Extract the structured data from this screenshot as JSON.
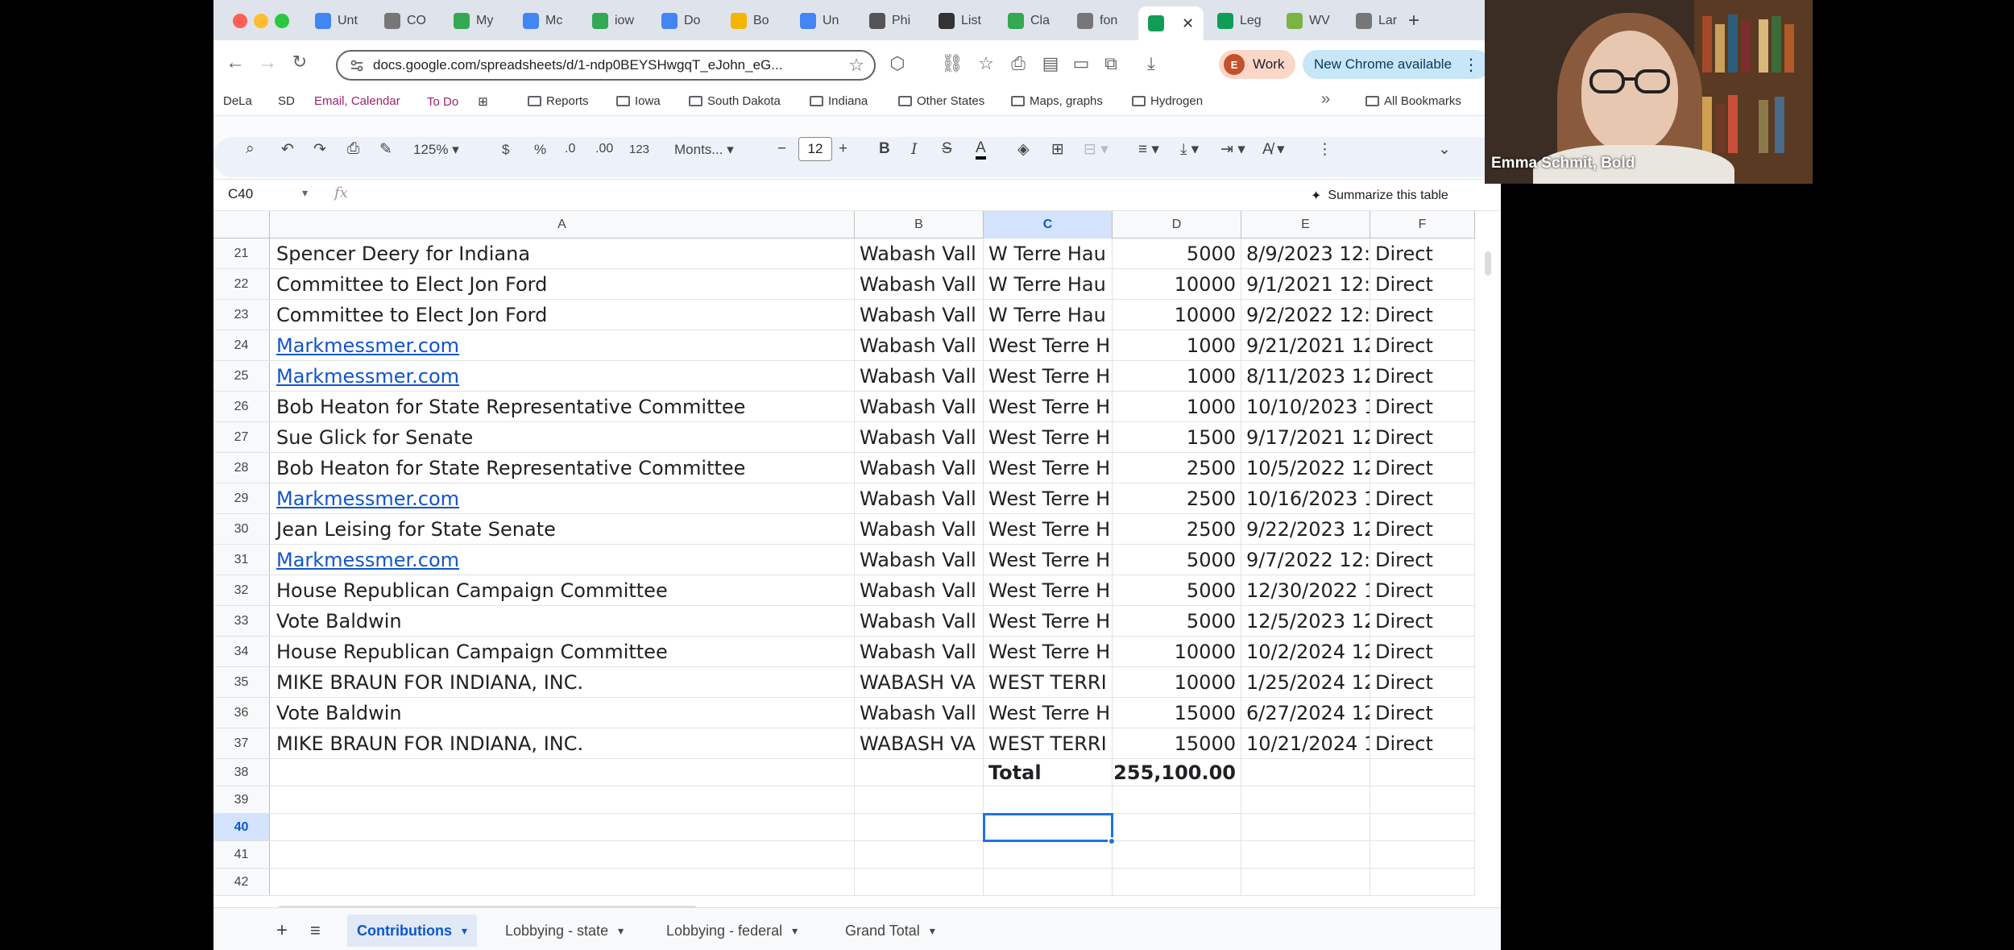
{
  "browser": {
    "tabs": [
      {
        "label": "Unt",
        "color": "#4285f4"
      },
      {
        "label": "CO",
        "color": "#777777"
      },
      {
        "label": "My",
        "color": "#34a853"
      },
      {
        "label": "Mc",
        "color": "#4285f4"
      },
      {
        "label": "iow",
        "color": "#34a853"
      },
      {
        "label": "Do",
        "color": "#4285f4"
      },
      {
        "label": "Bo",
        "color": "#f4b400"
      },
      {
        "label": "Un",
        "color": "#4285f4"
      },
      {
        "label": "Phi",
        "color": "#555555"
      },
      {
        "label": "List",
        "color": "#333333"
      },
      {
        "label": "Cla",
        "color": "#34a853"
      },
      {
        "label": "fon",
        "color": "#777777"
      },
      {
        "label": "",
        "color": "#0f9d58",
        "active": true
      },
      {
        "label": "Leg",
        "color": "#0f9d58"
      },
      {
        "label": "WV",
        "color": "#7cb342"
      },
      {
        "label": "Lar",
        "color": "#777777"
      }
    ],
    "url": "docs.google.com/spreadsheets/d/1-ndp0BEYSHwgqT_eJohn_eG...",
    "profile_label": "Work",
    "profile_initial": "E",
    "update_label": "New Chrome available",
    "bookmarks": [
      {
        "label": "DeLa",
        "folder": false
      },
      {
        "label": "SD",
        "folder": false
      },
      {
        "label": "Email, Calendar",
        "folder": false
      },
      {
        "label": "To Do",
        "folder": false
      },
      {
        "label": "Reports",
        "folder": true
      },
      {
        "label": "Iowa",
        "folder": true
      },
      {
        "label": "South Dakota",
        "folder": true
      },
      {
        "label": "Indiana",
        "folder": true
      },
      {
        "label": "Other States",
        "folder": true
      },
      {
        "label": "Maps, graphs",
        "folder": true
      },
      {
        "label": "Hydrogen",
        "folder": true
      }
    ],
    "all_bookmarks": "All Bookmarks"
  },
  "sheets": {
    "zoom": "125%",
    "currency": "$",
    "percent": "%",
    "dec_less": ".0",
    "dec_more": ".00",
    "number_format": "123",
    "font": "Monts...",
    "font_size": "12",
    "name_box": "C40",
    "fx": "fx",
    "summarize": "Summarize this table",
    "columns": [
      "A",
      "B",
      "C",
      "D",
      "E",
      "F"
    ],
    "rows": [
      {
        "n": "21",
        "a": "Spencer Deery for Indiana",
        "b": "Wabash Vall",
        "c": "W Terre Hau",
        "d": "5000",
        "e": "8/9/2023 12:0",
        "f": "Direct"
      },
      {
        "n": "22",
        "a": "Committee to Elect Jon Ford",
        "b": "Wabash Vall",
        "c": "W Terre Hau",
        "d": "10000",
        "e": "9/1/2021 12:0(",
        "f": "Direct"
      },
      {
        "n": "23",
        "a": "Committee to Elect Jon Ford",
        "b": "Wabash Vall",
        "c": "W Terre Hau",
        "d": "10000",
        "e": "9/2/2022 12:0",
        "f": "Direct"
      },
      {
        "n": "24",
        "a": "Markmessmer.com",
        "b": "Wabash Vall",
        "c": "West Terre H",
        "d": "1000",
        "e": "9/21/2021 12:0",
        "f": "Direct",
        "link": true
      },
      {
        "n": "25",
        "a": "Markmessmer.com",
        "b": "Wabash Vall",
        "c": "West Terre H",
        "d": "1000",
        "e": "8/11/2023 12:0",
        "f": "Direct",
        "link": true
      },
      {
        "n": "26",
        "a": "Bob Heaton for State Representative Committee",
        "b": "Wabash Vall",
        "c": "West Terre H",
        "d": "1000",
        "e": "10/10/2023 12",
        "f": "Direct"
      },
      {
        "n": "27",
        "a": "Sue Glick for Senate",
        "b": "Wabash Vall",
        "c": "West Terre H",
        "d": "1500",
        "e": "9/17/2021 12:0",
        "f": "Direct"
      },
      {
        "n": "28",
        "a": "Bob Heaton for State Representative Committee",
        "b": "Wabash Vall",
        "c": "West Terre H",
        "d": "2500",
        "e": "10/5/2022 12:",
        "f": "Direct"
      },
      {
        "n": "29",
        "a": "Markmessmer.com",
        "b": "Wabash Vall",
        "c": "West Terre H",
        "d": "2500",
        "e": "10/16/2023 12",
        "f": "Direct",
        "link": true
      },
      {
        "n": "30",
        "a": "Jean Leising for State Senate",
        "b": "Wabash Vall",
        "c": "West Terre H",
        "d": "2500",
        "e": "9/22/2023 12:",
        "f": "Direct"
      },
      {
        "n": "31",
        "a": "Markmessmer.com",
        "b": "Wabash Vall",
        "c": "West Terre H",
        "d": "5000",
        "e": "9/7/2022 12:0",
        "f": "Direct",
        "link": true
      },
      {
        "n": "32",
        "a": "House Republican Campaign Committee",
        "b": "Wabash Vall",
        "c": "West Terre H",
        "d": "5000",
        "e": "12/30/2022 12",
        "f": "Direct"
      },
      {
        "n": "33",
        "a": "Vote Baldwin",
        "b": "Wabash Vall",
        "c": "West Terre H",
        "d": "5000",
        "e": "12/5/2023 12:",
        "f": "Direct"
      },
      {
        "n": "34",
        "a": "House Republican Campaign Committee",
        "b": "Wabash Vall",
        "c": "West Terre H",
        "d": "10000",
        "e": "10/2/2024 12:",
        "f": "Direct"
      },
      {
        "n": "35",
        "a": "MIKE BRAUN FOR INDIANA, INC.",
        "b": "WABASH VA",
        "c": "WEST TERRI",
        "d": "10000",
        "e": "1/25/2024 12:",
        "f": "Direct"
      },
      {
        "n": "36",
        "a": "Vote Baldwin",
        "b": "Wabash Vall",
        "c": "West Terre H",
        "d": "15000",
        "e": "6/27/2024 12",
        "f": "Direct"
      },
      {
        "n": "37",
        "a": "MIKE BRAUN FOR INDIANA, INC.",
        "b": "WABASH VA",
        "c": "WEST TERRI",
        "d": "15000",
        "e": "10/21/2024 12",
        "f": "Direct"
      },
      {
        "n": "38",
        "a": "",
        "b": "",
        "c": "Total",
        "d": "$255,100.00",
        "e": "",
        "f": "",
        "bold": true
      },
      {
        "n": "39",
        "a": "",
        "b": "",
        "c": "",
        "d": "",
        "e": "",
        "f": ""
      },
      {
        "n": "40",
        "a": "",
        "b": "",
        "c": "",
        "d": "",
        "e": "",
        "f": "",
        "selected": true
      },
      {
        "n": "41",
        "a": "",
        "b": "",
        "c": "",
        "d": "",
        "e": "",
        "f": ""
      },
      {
        "n": "42",
        "a": "",
        "b": "",
        "c": "",
        "d": "",
        "e": "",
        "f": ""
      }
    ],
    "sheet_tabs": [
      {
        "label": "Contributions",
        "active": true
      },
      {
        "label": "Lobbying - state"
      },
      {
        "label": "Lobbying - federal"
      },
      {
        "label": "Grand Total"
      }
    ]
  },
  "video": {
    "participant": "Emma Schmit, Bold"
  }
}
